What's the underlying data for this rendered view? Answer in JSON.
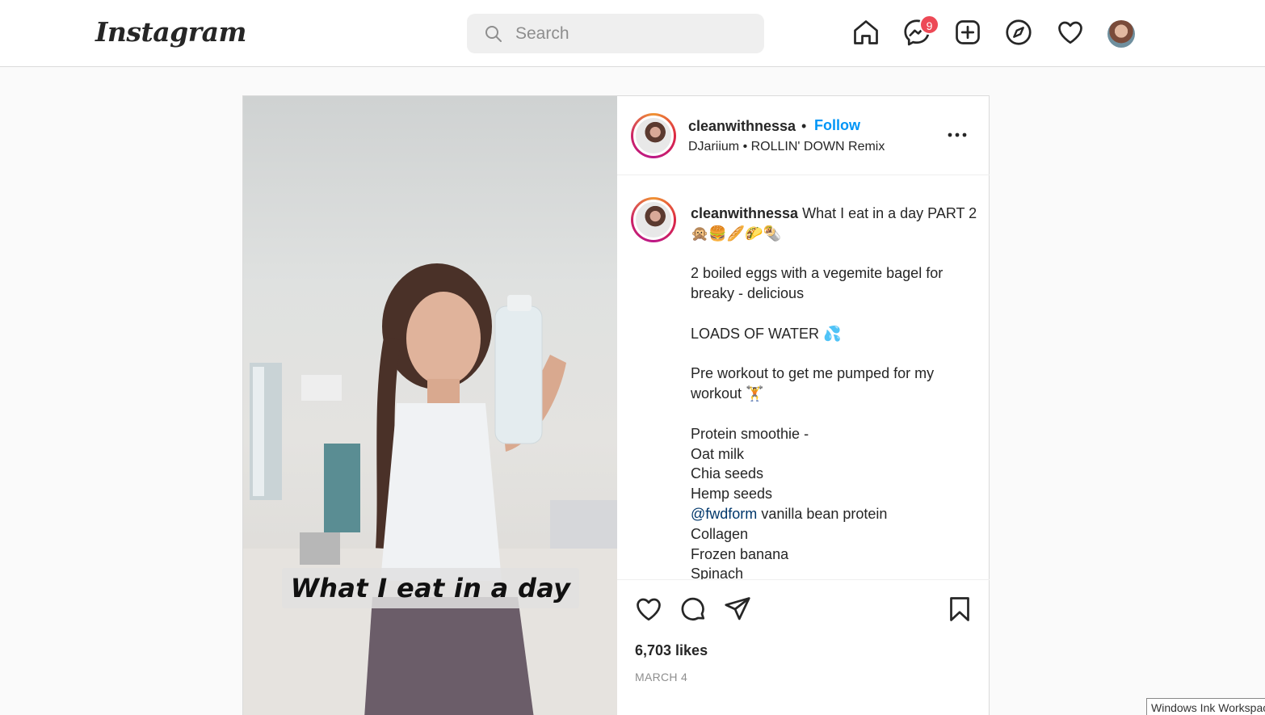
{
  "nav": {
    "logo": "Instagram",
    "search_placeholder": "Search",
    "messenger_badge": "9",
    "icons": [
      "home-icon",
      "messenger-icon",
      "new-post-icon",
      "explore-icon",
      "activity-heart-icon",
      "profile-avatar"
    ]
  },
  "post": {
    "overlay_text": "What I eat in a day",
    "header": {
      "username": "cleanwithnessa",
      "separator": "•",
      "follow_label": "Follow",
      "audio": "DJariium • ROLLIN' DOWN Remix"
    },
    "caption": {
      "username": "cleanwithnessa",
      "lines": [
        "What I eat in a day PART 2 🙊🍔🥖🌮🌯",
        "",
        "2 boiled eggs with a vegemite bagel for breaky - delicious",
        "",
        "LOADS OF WATER 💦",
        "",
        "Pre workout to get me pumped for my workout 🏋️",
        "",
        "Protein smoothie -",
        "Oat milk",
        "Chia seeds",
        "Hemp seeds",
        "vanilla bean protein",
        "Collagen",
        "Frozen banana",
        "Spinach"
      ],
      "mention": "@fwdform"
    },
    "likes": "6,703 likes",
    "date": "MARCH 4"
  },
  "taskbar_tooltip": "Windows Ink Workspace"
}
